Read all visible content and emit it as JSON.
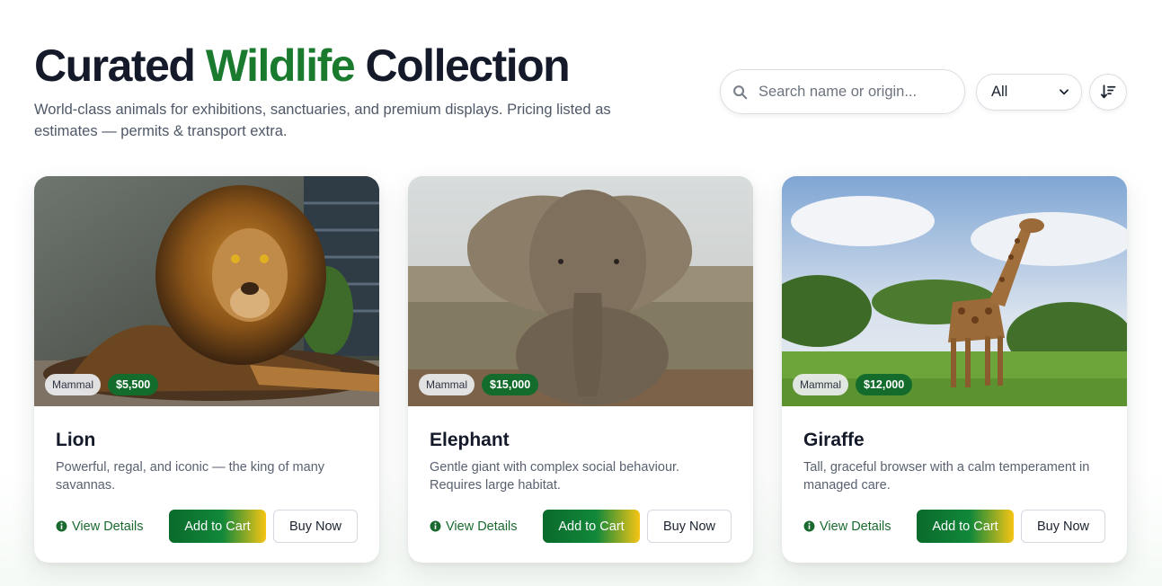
{
  "header": {
    "title_part1": "Curated ",
    "title_accent": "Wildlife",
    "title_part2": " Collection",
    "subtitle": "World-class animals for exhibitions, sanctuaries, and premium displays. Pricing listed as estimates — permits & transport extra."
  },
  "controls": {
    "search_placeholder": "Search name or origin...",
    "filter_value": "All",
    "icons": {
      "search": "search-icon",
      "filter": "chevron-down-icon",
      "sort": "sort-descending-icon"
    }
  },
  "colors": {
    "brand_green": "#1a7a2e",
    "price_badge": "#136b2c",
    "gradient_end": "#f6c515"
  },
  "cards": [
    {
      "name": "Lion",
      "category": "Mammal",
      "price": "$5,500",
      "description": "Powerful, regal, and iconic — the king of many savannas.",
      "details_label": "View Details",
      "cart_label": "Add to Cart",
      "buy_label": "Buy Now"
    },
    {
      "name": "Elephant",
      "category": "Mammal",
      "price": "$15,000",
      "description": "Gentle giant with complex social behaviour. Requires large habitat.",
      "details_label": "View Details",
      "cart_label": "Add to Cart",
      "buy_label": "Buy Now"
    },
    {
      "name": "Giraffe",
      "category": "Mammal",
      "price": "$12,000",
      "description": "Tall, graceful browser with a calm temperament in managed care.",
      "details_label": "View Details",
      "cart_label": "Add to Cart",
      "buy_label": "Buy Now"
    }
  ]
}
